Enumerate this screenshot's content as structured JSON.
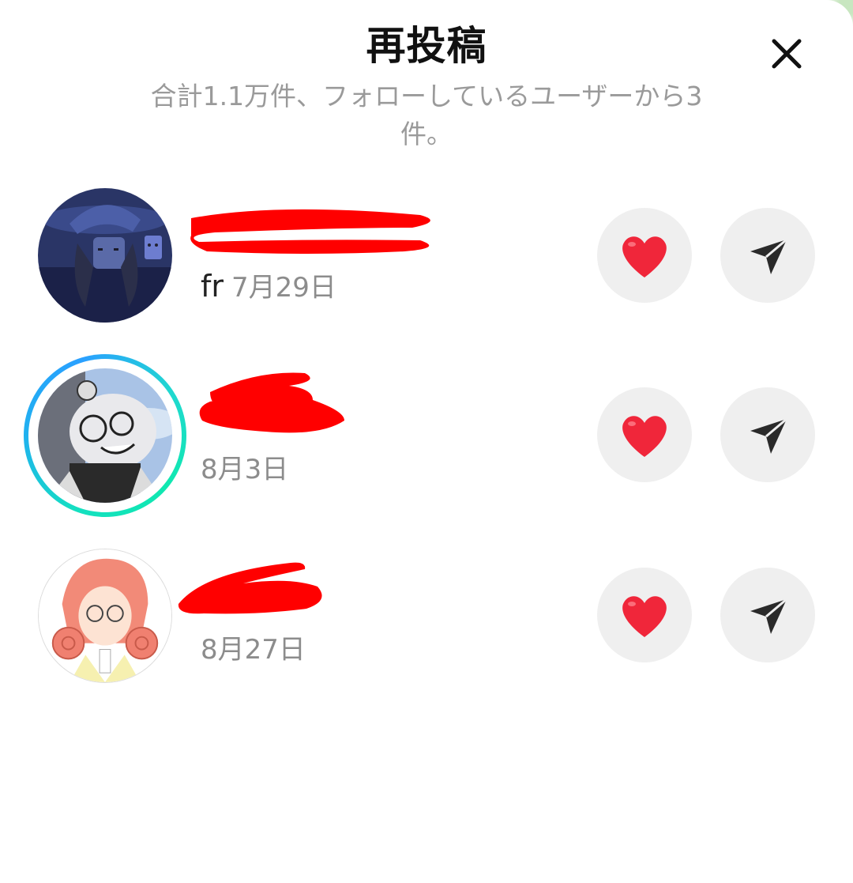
{
  "sheet": {
    "title": "再投稿",
    "subtitle": "合計1.1万件、フォローしているユーザーから3件。",
    "close_icon": "close-icon"
  },
  "reposts": [
    {
      "name": "fr",
      "date": "7月29日",
      "name_redacted": true,
      "story_ring": false
    },
    {
      "name": "",
      "date": "8月3日",
      "name_redacted": true,
      "story_ring": true
    },
    {
      "name": "",
      "date": "8月27日",
      "name_redacted": true,
      "story_ring": false
    }
  ],
  "actions": {
    "like_icon": "heart-icon",
    "share_icon": "paper-plane-icon"
  },
  "colors": {
    "heart": "#f0263a",
    "redaction": "#ff0000",
    "button_bg": "#efefef",
    "subtle_text": "#9a9a9a",
    "ring_start": "#20b0f0",
    "ring_end": "#10e8b0"
  }
}
